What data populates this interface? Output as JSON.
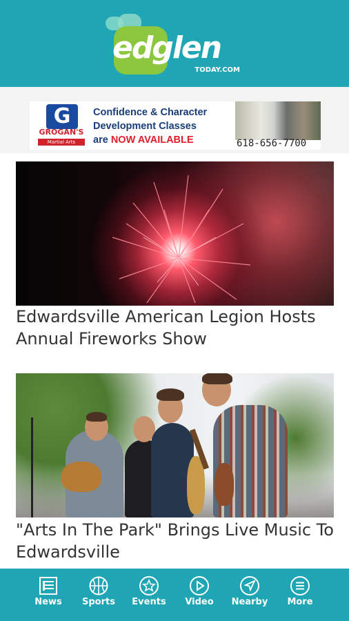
{
  "header": {
    "logo_word": "edglen",
    "logo_sub": "TODAY.COM",
    "bg_color": "#1fa5b3",
    "logo_accent": "#8dc63f"
  },
  "ad": {
    "brand_initial": "G",
    "brand_name": "GROGAN'S",
    "brand_sub": "Martial Arts",
    "line1": "Confidence & Character",
    "line2": "Development Classes",
    "line3_start": "are ",
    "line3_highlight": "NOW AVAILABLE",
    "phone": "618-656-7700"
  },
  "stories": [
    {
      "title": "Edwardsville American Legion Hosts Annual Fireworks Show",
      "image_icon": "fireworks-photo"
    },
    {
      "title": "\"Arts In The Park\" Brings Live Music To Edwardsville",
      "image_icon": "musicians-photo"
    }
  ],
  "tabbar": {
    "bg_color": "#1fa5b3",
    "items": [
      {
        "label": "News",
        "icon": "news-icon"
      },
      {
        "label": "Sports",
        "icon": "basketball-icon"
      },
      {
        "label": "Events",
        "icon": "star-icon"
      },
      {
        "label": "Video",
        "icon": "play-icon"
      },
      {
        "label": "Nearby",
        "icon": "navigation-icon"
      },
      {
        "label": "More",
        "icon": "menu-icon"
      }
    ]
  }
}
